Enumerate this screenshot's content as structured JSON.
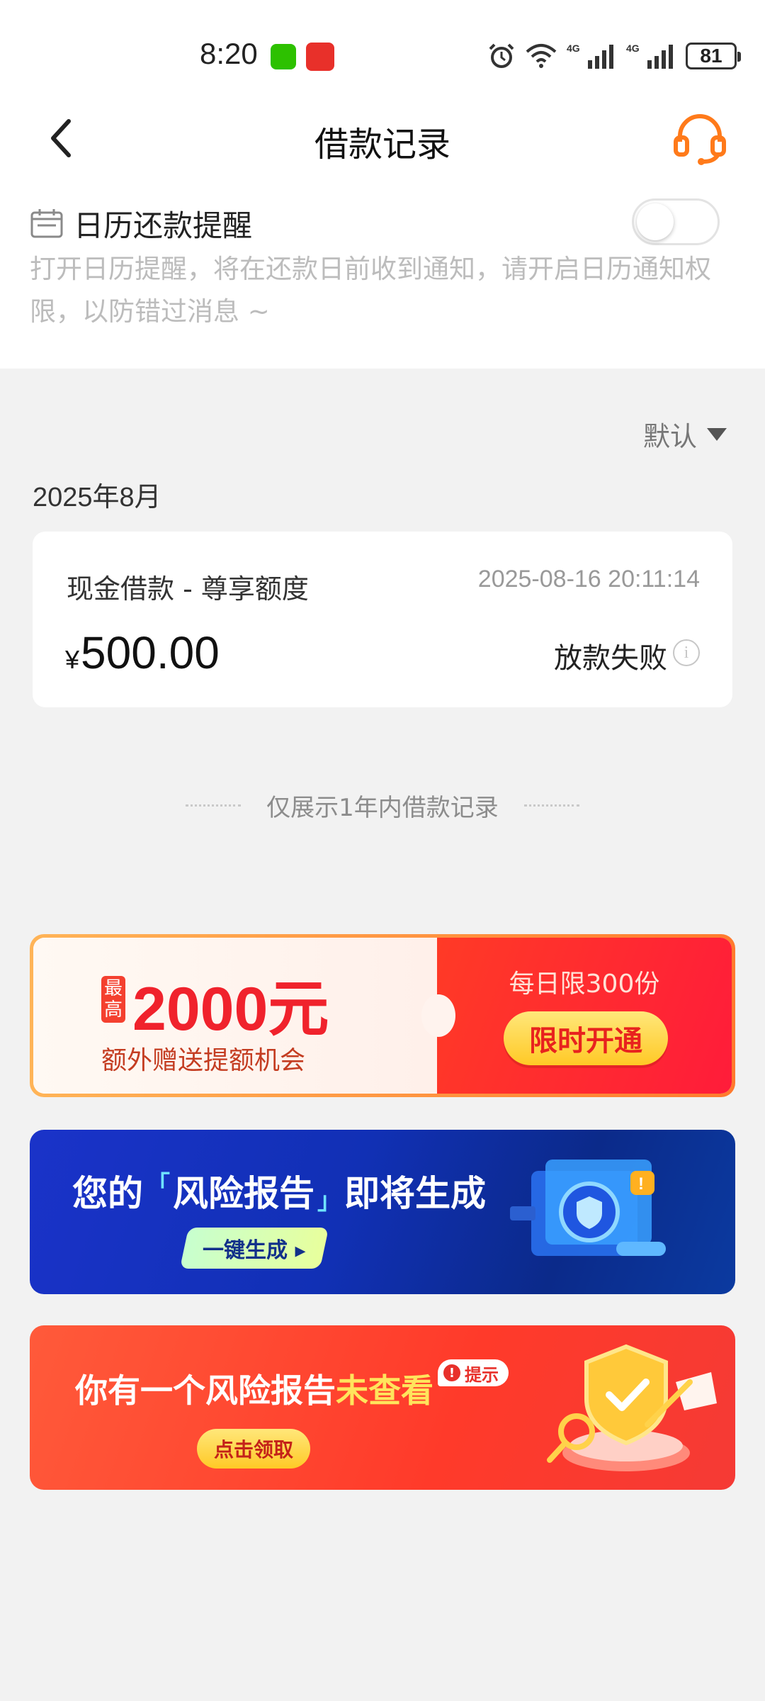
{
  "status_bar": {
    "time": "8:20",
    "battery": "81",
    "icons": [
      "wechat-icon",
      "app-notification-icon",
      "alarm-icon",
      "wifi-icon",
      "signal-4g-icon",
      "signal-4g-icon",
      "battery-icon"
    ]
  },
  "nav": {
    "title": "借款记录",
    "back_icon": "chevron-left-icon",
    "service_icon": "headset-icon"
  },
  "calendar_reminder": {
    "label": "日历还款提醒",
    "description": "打开日历提醒，将在还款日前收到通知，请开启日历通知权限，以防错过消息 ~",
    "enabled": false
  },
  "sort": {
    "label": "默认"
  },
  "records": {
    "month": "2025年8月",
    "items": [
      {
        "product": "现金借款 - 尊享额度",
        "time": "2025-08-16 20:11:14",
        "currency": "¥",
        "amount": "500.00",
        "status": "放款失败"
      }
    ],
    "footer_note": "仅展示1年内借款记录"
  },
  "banners": {
    "quota": {
      "max_tag": "最高",
      "amount": "2000元",
      "subtitle": "额外赠送提额机会",
      "limit": "每日限300份",
      "cta": "限时开通"
    },
    "risk_report": {
      "title_prefix": "您的",
      "title_highlight": "风险报告",
      "title_suffix": "即将生成",
      "cta": "一键生成 ▸"
    },
    "unread_report": {
      "title_prefix": "你有一个风险报告",
      "title_highlight": "未查看",
      "tip": "提示",
      "cta": "点击领取"
    }
  },
  "colors": {
    "accent_orange": "#ff7a1a",
    "background": "#f2f2f2",
    "muted_text": "#bcbcbc"
  }
}
